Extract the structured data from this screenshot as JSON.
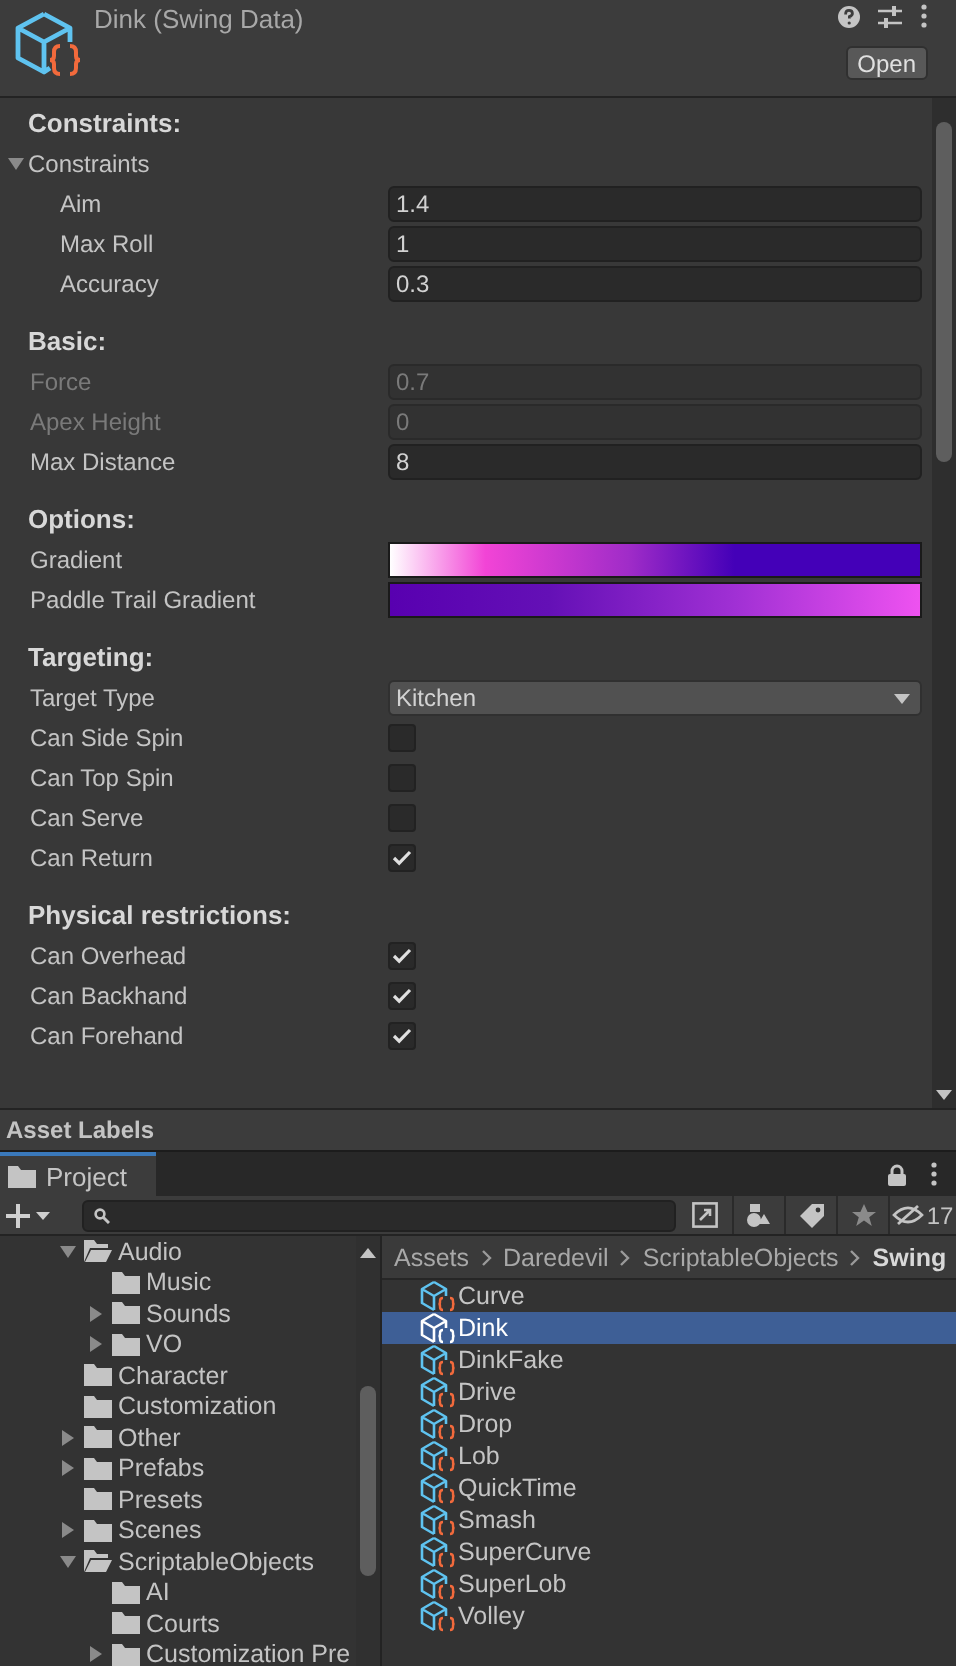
{
  "window": {
    "title": "Dink (Swing Data)",
    "open_button": "Open"
  },
  "inspector": [
    {
      "kind": "header",
      "label": "Constraints:"
    },
    {
      "kind": "foldout",
      "label": "Constraints",
      "expanded": true,
      "children": [
        {
          "kind": "number",
          "label": "Aim",
          "value": "1.4",
          "disabled": false
        },
        {
          "kind": "number",
          "label": "Max Roll",
          "value": "1",
          "disabled": false
        },
        {
          "kind": "number",
          "label": "Accuracy",
          "value": "0.3",
          "disabled": false
        }
      ]
    },
    {
      "kind": "header",
      "label": "Basic:"
    },
    {
      "kind": "number",
      "label": "Force",
      "value": "0.7",
      "disabled": true
    },
    {
      "kind": "number",
      "label": "Apex Height",
      "value": "0",
      "disabled": true
    },
    {
      "kind": "number",
      "label": "Max Distance",
      "value": "8",
      "disabled": false
    },
    {
      "kind": "header",
      "label": "Options:"
    },
    {
      "kind": "gradient",
      "label": "Gradient"
    },
    {
      "kind": "gradient",
      "label": "Paddle Trail Gradient"
    },
    {
      "kind": "header",
      "label": "Targeting:"
    },
    {
      "kind": "dropdown",
      "label": "Target Type",
      "value": "Kitchen"
    },
    {
      "kind": "checkbox",
      "label": "Can Side Spin",
      "checked": false
    },
    {
      "kind": "checkbox",
      "label": "Can Top Spin",
      "checked": false
    },
    {
      "kind": "checkbox",
      "label": "Can Serve",
      "checked": false
    },
    {
      "kind": "checkbox",
      "label": "Can Return",
      "checked": true
    },
    {
      "kind": "header",
      "label": "Physical restrictions:"
    },
    {
      "kind": "checkbox",
      "label": "Can Overhead",
      "checked": true
    },
    {
      "kind": "checkbox",
      "label": "Can Backhand",
      "checked": true
    },
    {
      "kind": "checkbox",
      "label": "Can Forehand",
      "checked": true
    }
  ],
  "asset_labels": "Asset Labels",
  "project": {
    "tab": "Project",
    "hidden_count": "17",
    "tree": [
      {
        "label": "Audio",
        "expanded": true,
        "children": [
          {
            "label": "Music"
          },
          {
            "label": "Sounds",
            "expanded": false
          },
          {
            "label": "VO",
            "expanded": false
          }
        ]
      },
      {
        "label": "Character"
      },
      {
        "label": "Customization"
      },
      {
        "label": "Other",
        "expanded": false
      },
      {
        "label": "Prefabs",
        "expanded": false
      },
      {
        "label": "Presets"
      },
      {
        "label": "Scenes",
        "expanded": false
      },
      {
        "label": "ScriptableObjects",
        "expanded": true,
        "children": [
          {
            "label": "AI"
          },
          {
            "label": "Courts"
          },
          {
            "label": "Customization Pre",
            "expanded": false
          }
        ]
      }
    ],
    "breadcrumb": [
      "Assets",
      "Daredevil",
      "ScriptableObjects",
      "Swing"
    ],
    "assets": [
      {
        "name": "Curve",
        "selected": false
      },
      {
        "name": "Dink",
        "selected": true
      },
      {
        "name": "DinkFake",
        "selected": false
      },
      {
        "name": "Drive",
        "selected": false
      },
      {
        "name": "Drop",
        "selected": false
      },
      {
        "name": "Lob",
        "selected": false
      },
      {
        "name": "QuickTime",
        "selected": false
      },
      {
        "name": "Smash",
        "selected": false
      },
      {
        "name": "SuperCurve",
        "selected": false
      },
      {
        "name": "SuperLob",
        "selected": false
      },
      {
        "name": "Volley",
        "selected": false
      }
    ]
  }
}
